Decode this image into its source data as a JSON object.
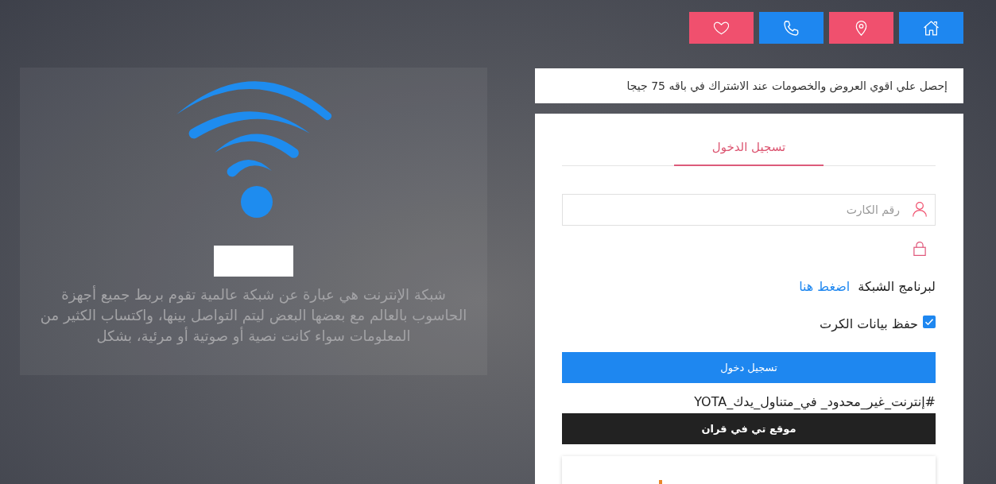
{
  "nav_buttons": [
    {
      "kind": "home",
      "color": "#1e87f0"
    },
    {
      "kind": "pin",
      "color": "#f0506e"
    },
    {
      "kind": "phone",
      "color": "#1e87f0"
    },
    {
      "kind": "heart",
      "color": "#f0506e"
    }
  ],
  "promo_banner": {
    "text": "إحصل علي اقوي العروض والخصومات عند الاشتراك في باقه 75 جيجا"
  },
  "login": {
    "tabs": [
      {
        "label": "تسجيل الدخول",
        "selected": true
      }
    ],
    "card_field": {
      "placeholder": "رقم الكارت"
    },
    "network_note": {
      "text": "لبرنامج الشبكة",
      "link": "اضغط هنا"
    },
    "remember": {
      "label": "حفظ بيانات الكرت",
      "checked": true
    },
    "submit_button": "تسجيل دخول",
    "hashtag": "#إنترنت_غير_محدود_ في_متناول_يدك_YOTA",
    "site_bar": "موقع تي في قران"
  },
  "info_panel": {
    "text": "شبكة الإنترنت هي عبارة عن شبكة عالمية تقوم بربط جميع أجهزة الحاسوب بالعالم مع بعضها البعض ليتم التواصل بينها، واكتساب الكثير من المعلومات سواء كانت نصية أو صوتية أو مرئية، بشكل"
  }
}
